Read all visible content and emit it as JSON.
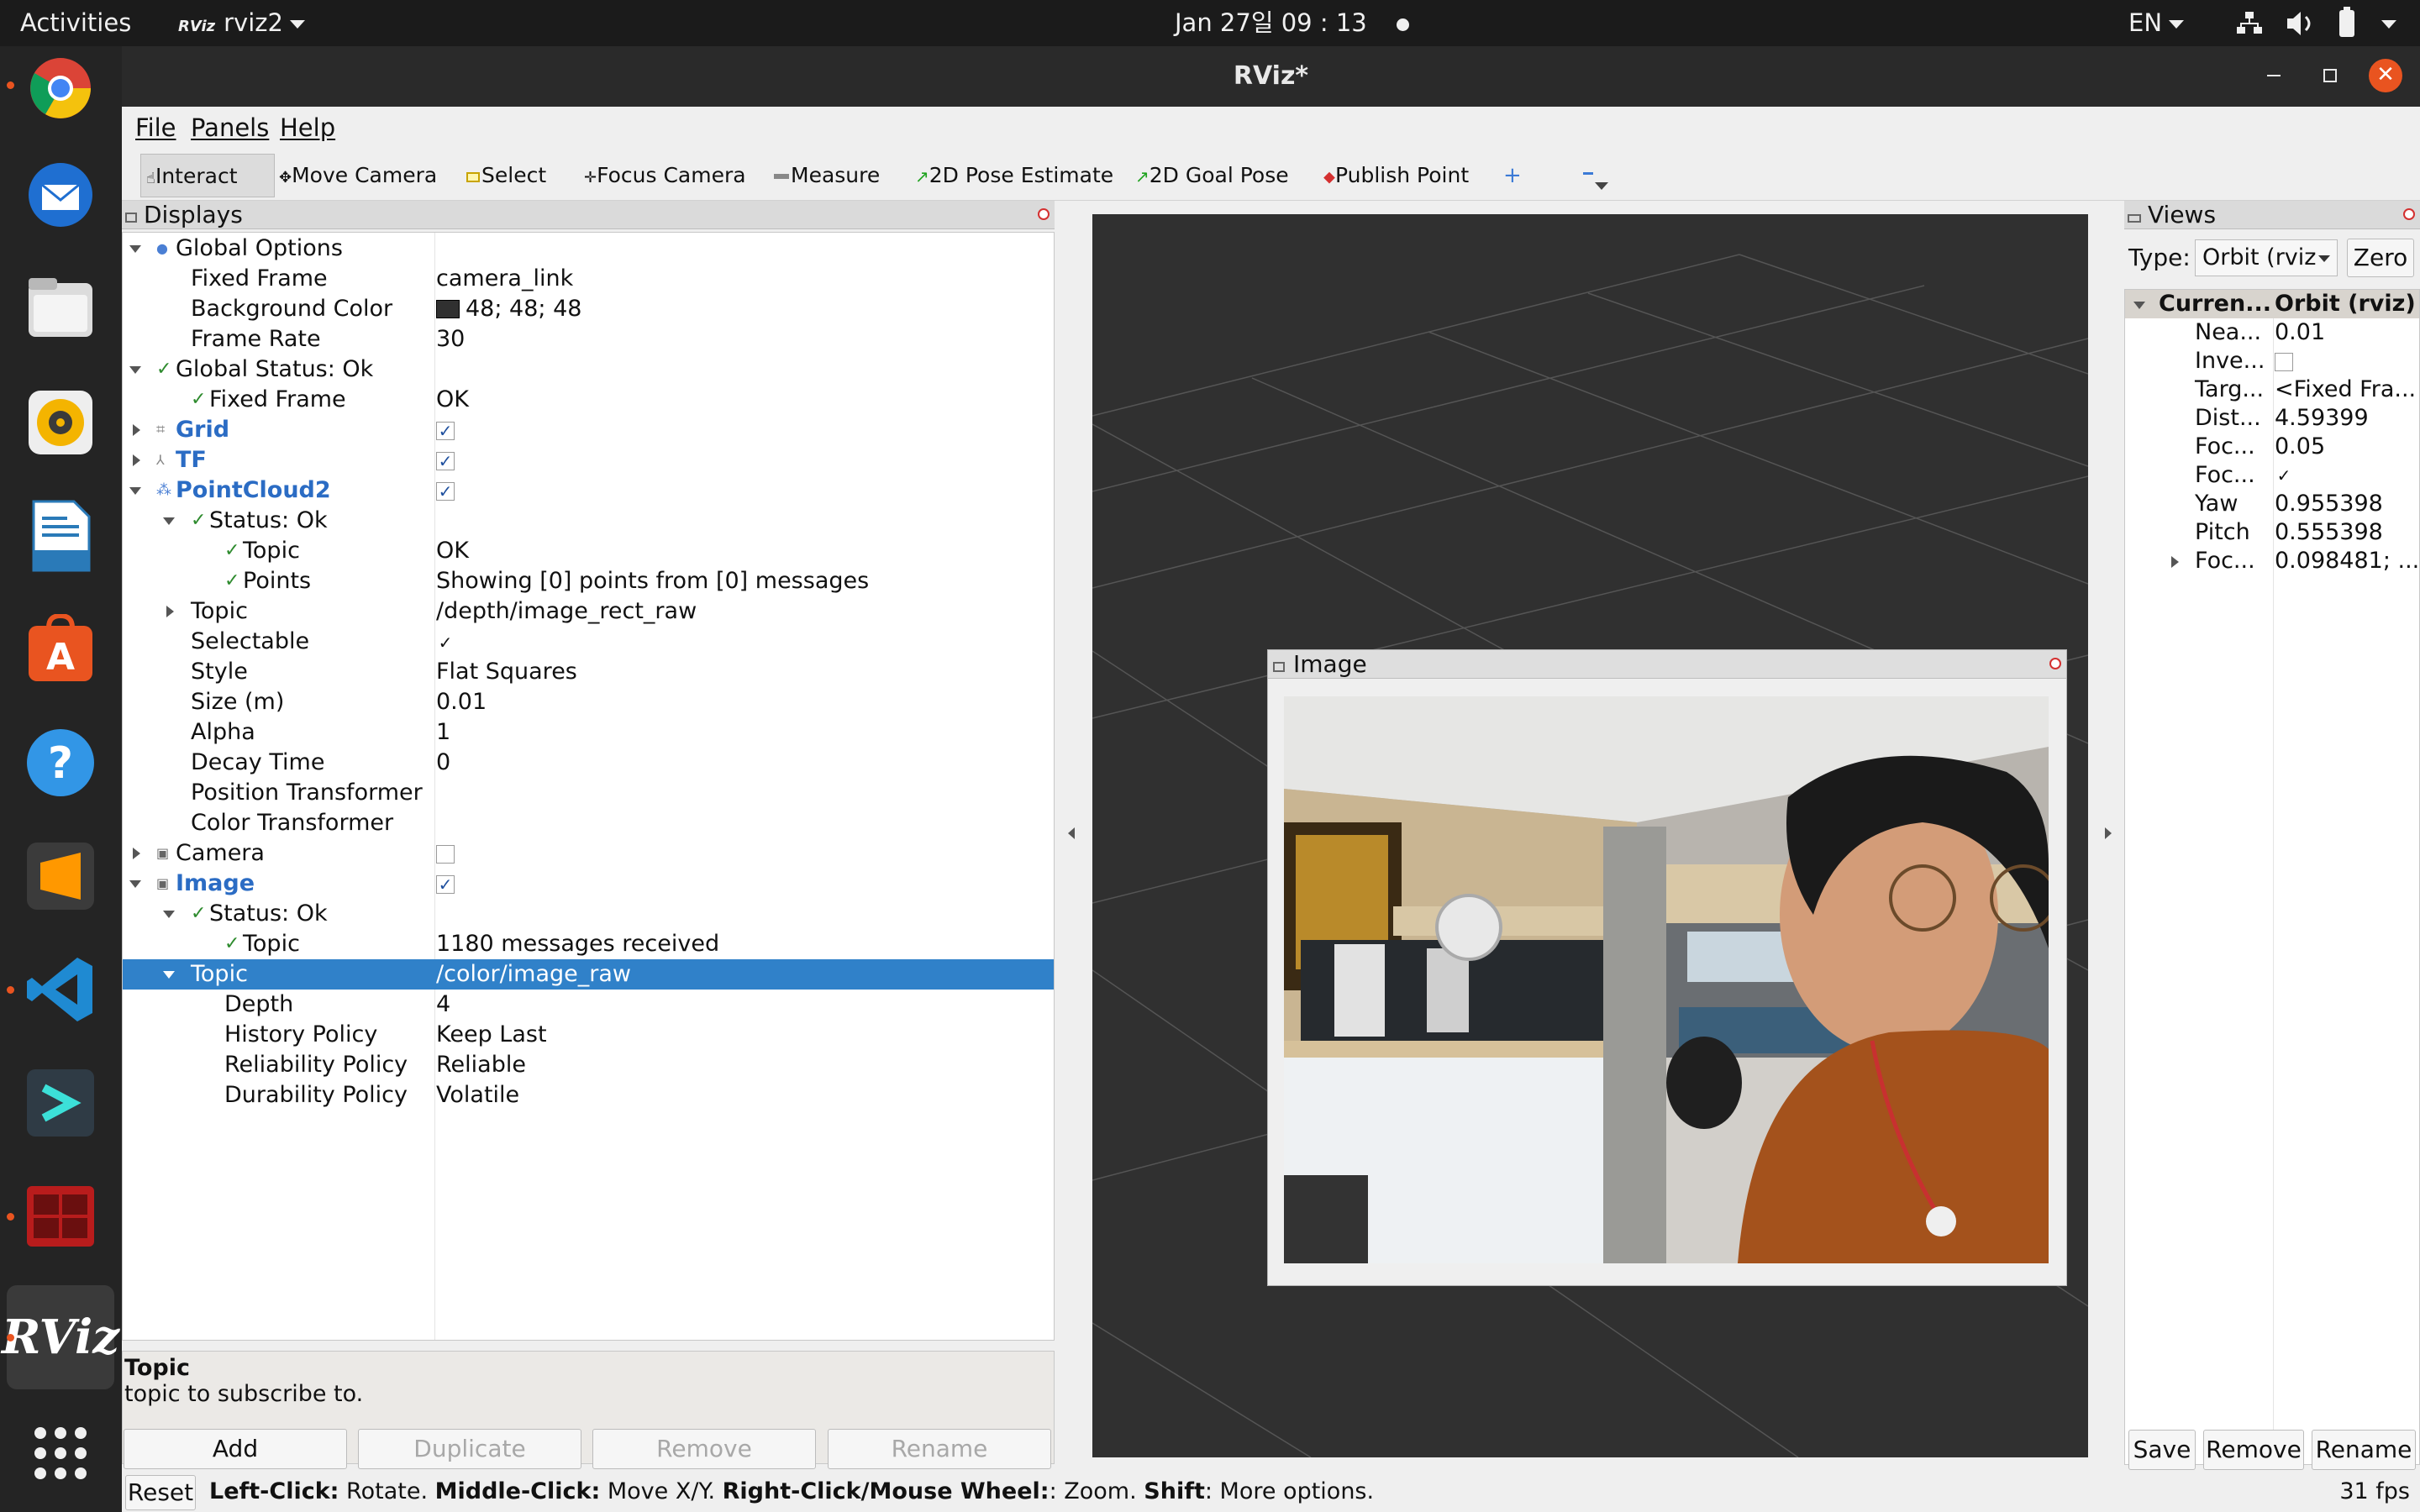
{
  "topbar": {
    "activities": "Activities",
    "app_label": "rviz2",
    "app_badge": "RViz",
    "clock": "Jan 27일  09 : 13",
    "lang": "EN"
  },
  "window": {
    "title": "RViz*"
  },
  "menu": {
    "file": "File",
    "panels": "Panels",
    "help": "Help"
  },
  "toolbar": {
    "interact": "Interact",
    "move_camera": "Move Camera",
    "select": "Select",
    "focus_camera": "Focus Camera",
    "measure": "Measure",
    "pose_estimate": "2D Pose Estimate",
    "goal_pose": "2D Goal Pose",
    "publish_point": "Publish Point"
  },
  "displays": {
    "title": "Displays",
    "rows": {
      "global_options": "Global Options",
      "fixed_frame": "Fixed Frame",
      "fixed_frame_v": "camera_link",
      "bg_color": "Background Color",
      "bg_color_v": "48; 48; 48",
      "frame_rate": "Frame Rate",
      "frame_rate_v": "30",
      "global_status": "Global Status: Ok",
      "gs_fixed_frame": "Fixed Frame",
      "gs_fixed_frame_v": "OK",
      "grid": "Grid",
      "tf": "TF",
      "pointcloud2": "PointCloud2",
      "pc_status": "Status: Ok",
      "pc_topic_status": "Topic",
      "pc_topic_status_v": "OK",
      "pc_points": "Points",
      "pc_points_v": "Showing [0] points from [0] messages",
      "pc_topic": "Topic",
      "pc_topic_v": "/depth/image_rect_raw",
      "selectable": "Selectable",
      "style": "Style",
      "style_v": "Flat Squares",
      "size": "Size (m)",
      "size_v": "0.01",
      "alpha": "Alpha",
      "alpha_v": "1",
      "decay": "Decay Time",
      "decay_v": "0",
      "pos_tf": "Position Transformer",
      "color_tf": "Color Transformer",
      "camera": "Camera",
      "image": "Image",
      "img_status": "Status: Ok",
      "img_topic_status": "Topic",
      "img_topic_status_v": "1180 messages received",
      "img_topic": "Topic",
      "img_topic_v": "/color/image_raw",
      "depth": "Depth",
      "depth_v": "4",
      "history": "History Policy",
      "history_v": "Keep Last",
      "reliability": "Reliability Policy",
      "reliability_v": "Reliable",
      "durability": "Durability Policy",
      "durability_v": "Volatile"
    },
    "desc_title": "Topic",
    "desc_text": "topic to subscribe to.",
    "buttons": {
      "add": "Add",
      "duplicate": "Duplicate",
      "remove": "Remove",
      "rename": "Rename"
    }
  },
  "image_panel": {
    "title": "Image"
  },
  "views": {
    "title": "Views",
    "type_label": "Type:",
    "type_value": "Orbit (rviz",
    "zero": "Zero",
    "header_k": "Curren...",
    "header_v": "Orbit (rviz)",
    "rows": [
      {
        "k": "Nea...",
        "v": "0.01"
      },
      {
        "k": "Inve...",
        "v": ""
      },
      {
        "k": "Targ...",
        "v": "<Fixed Fra..."
      },
      {
        "k": "Dist...",
        "v": "4.59399"
      },
      {
        "k": "Foc...",
        "v": "0.05"
      },
      {
        "k": "Foc...",
        "v": ""
      },
      {
        "k": "Yaw",
        "v": "0.955398"
      },
      {
        "k": "Pitch",
        "v": "0.555398"
      },
      {
        "k": "Foc...",
        "v": "0.098481; ..."
      }
    ],
    "buttons": {
      "save": "Save",
      "remove": "Remove",
      "rename": "Rename"
    }
  },
  "status": {
    "reset": "Reset",
    "lc": "Left-Click:",
    "lc_t": " Rotate. ",
    "mc": "Middle-Click:",
    "mc_t": " Move X/Y. ",
    "rc": "Right-Click/Mouse Wheel:",
    "rc_t": ": Zoom. ",
    "sh": "Shift",
    "sh_t": ": More options.",
    "fps": "31 fps"
  },
  "colors": {
    "selection": "#3081c9",
    "viewport_bg": "#303030",
    "accent": "#e95420"
  }
}
